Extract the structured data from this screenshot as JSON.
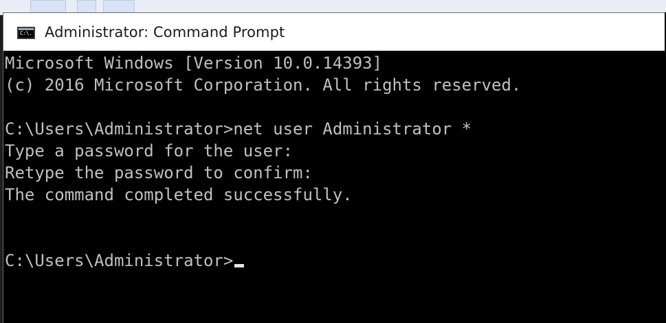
{
  "window": {
    "title": "Administrator: Command Prompt",
    "icon_label": "C:\\."
  },
  "console": {
    "lines": [
      "Microsoft Windows [Version 10.0.14393]",
      "(c) 2016 Microsoft Corporation. All rights reserved.",
      "",
      "C:\\Users\\Administrator>net user Administrator *",
      "Type a password for the user:",
      "Retype the password to confirm:",
      "The command completed successfully.",
      "",
      ""
    ],
    "prompt": "C:\\Users\\Administrator>"
  },
  "colors": {
    "console_bg": "#000000",
    "console_text": "#c0c0c0",
    "titlebar_bg": "#ffffff"
  },
  "icons": {
    "app": "cmd-app-icon",
    "cursor": "text-cursor"
  }
}
